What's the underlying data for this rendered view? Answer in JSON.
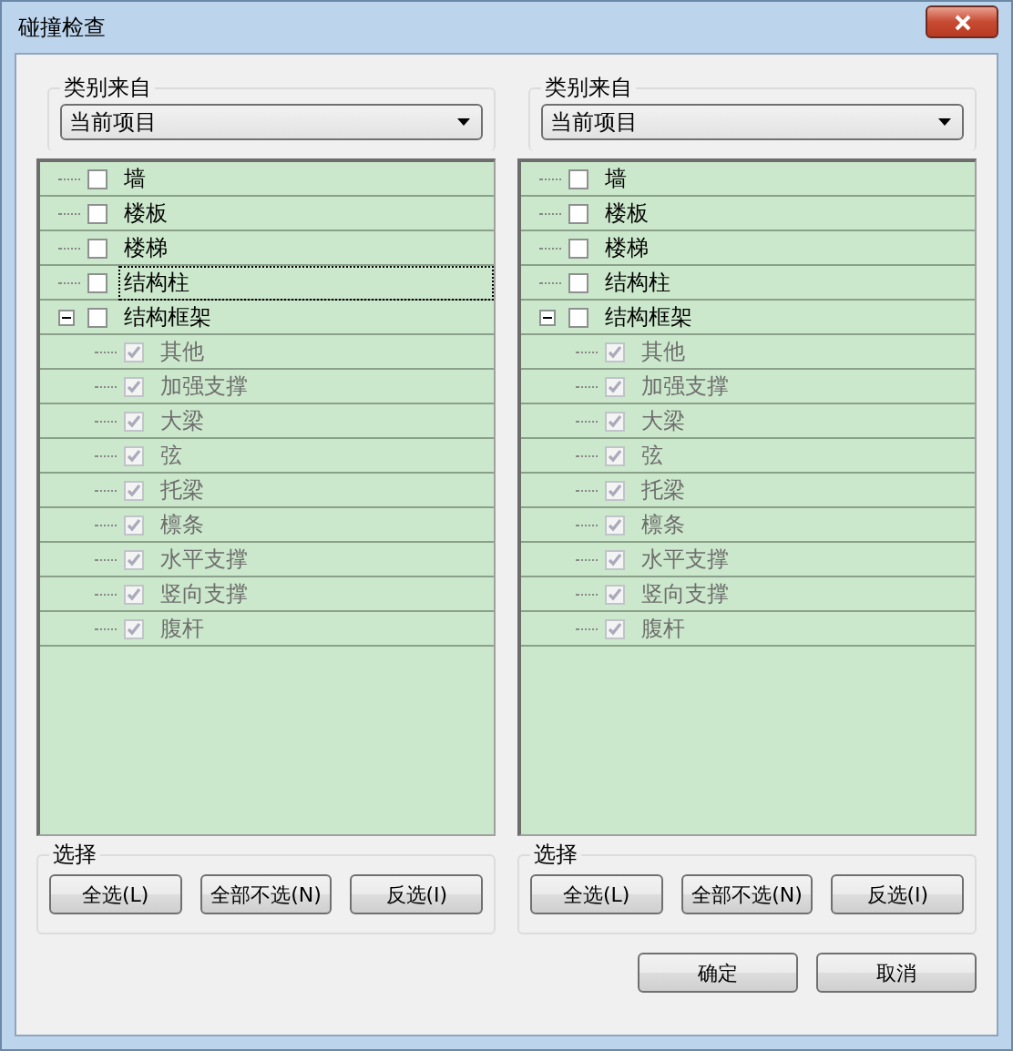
{
  "window": {
    "title": "碰撞检查"
  },
  "panels": [
    {
      "category_label": "类别来自",
      "source": "当前项目",
      "tree": [
        {
          "label": "墙",
          "checked": false,
          "disabled": false,
          "focused": false
        },
        {
          "label": "楼板",
          "checked": false,
          "disabled": false,
          "focused": false
        },
        {
          "label": "楼梯",
          "checked": false,
          "disabled": false,
          "focused": false
        },
        {
          "label": "结构柱",
          "checked": false,
          "disabled": false,
          "focused": true
        },
        {
          "label": "结构框架",
          "checked": false,
          "disabled": false,
          "focused": false,
          "expanded": true,
          "children": [
            {
              "label": "其他",
              "checked": true,
              "disabled": true,
              "focused": false
            },
            {
              "label": "加强支撑",
              "checked": true,
              "disabled": true,
              "focused": false
            },
            {
              "label": "大梁",
              "checked": true,
              "disabled": true,
              "focused": false
            },
            {
              "label": "弦",
              "checked": true,
              "disabled": true,
              "focused": false
            },
            {
              "label": "托梁",
              "checked": true,
              "disabled": true,
              "focused": false
            },
            {
              "label": "檩条",
              "checked": true,
              "disabled": true,
              "focused": false
            },
            {
              "label": "水平支撑",
              "checked": true,
              "disabled": true,
              "focused": false
            },
            {
              "label": "竖向支撑",
              "checked": true,
              "disabled": true,
              "focused": false
            },
            {
              "label": "腹杆",
              "checked": true,
              "disabled": true,
              "focused": false
            }
          ]
        }
      ],
      "select_label": "选择",
      "buttons": [
        "全选(L)",
        "全部不选(N)",
        "反选(I)"
      ]
    },
    {
      "category_label": "类别来自",
      "source": "当前项目",
      "tree": [
        {
          "label": "墙",
          "checked": false,
          "disabled": false,
          "focused": false
        },
        {
          "label": "楼板",
          "checked": false,
          "disabled": false,
          "focused": false
        },
        {
          "label": "楼梯",
          "checked": false,
          "disabled": false,
          "focused": false
        },
        {
          "label": "结构柱",
          "checked": false,
          "disabled": false,
          "focused": false
        },
        {
          "label": "结构框架",
          "checked": false,
          "disabled": false,
          "focused": false,
          "expanded": true,
          "children": [
            {
              "label": "其他",
              "checked": true,
              "disabled": true,
              "focused": false
            },
            {
              "label": "加强支撑",
              "checked": true,
              "disabled": true,
              "focused": false
            },
            {
              "label": "大梁",
              "checked": true,
              "disabled": true,
              "focused": false
            },
            {
              "label": "弦",
              "checked": true,
              "disabled": true,
              "focused": false
            },
            {
              "label": "托梁",
              "checked": true,
              "disabled": true,
              "focused": false
            },
            {
              "label": "檩条",
              "checked": true,
              "disabled": true,
              "focused": false
            },
            {
              "label": "水平支撑",
              "checked": true,
              "disabled": true,
              "focused": false
            },
            {
              "label": "竖向支撑",
              "checked": true,
              "disabled": true,
              "focused": false
            },
            {
              "label": "腹杆",
              "checked": true,
              "disabled": true,
              "focused": false
            }
          ]
        }
      ],
      "select_label": "选择",
      "buttons": [
        "全选(L)",
        "全部不选(N)",
        "反选(I)"
      ]
    }
  ],
  "footer_buttons": [
    "确定",
    "取消"
  ]
}
